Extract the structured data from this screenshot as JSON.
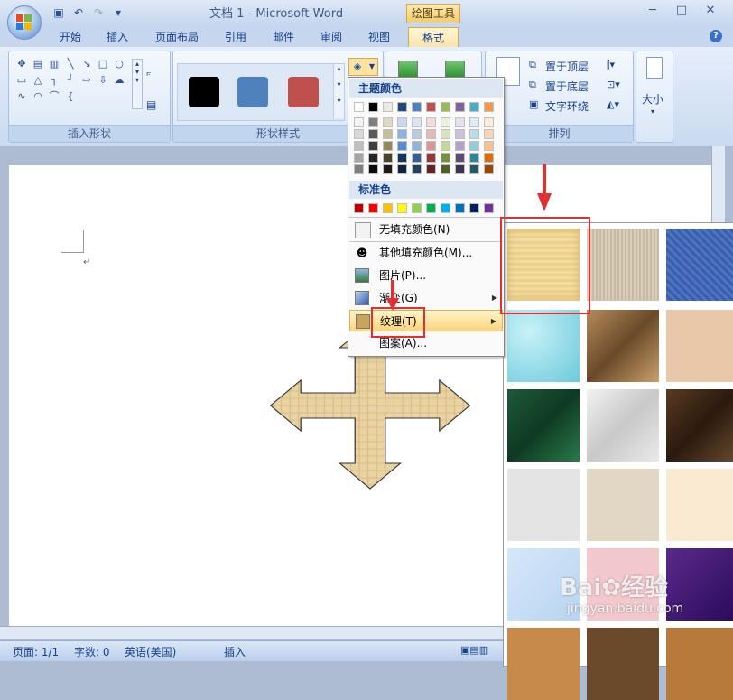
{
  "window": {
    "title": "文档 1 - Microsoft Word",
    "tools_tab": "绘图工具",
    "controls": [
      "─",
      "□",
      "✕"
    ]
  },
  "tabs": [
    {
      "label": "开始"
    },
    {
      "label": "插入"
    },
    {
      "label": "页面布局"
    },
    {
      "label": "引用"
    },
    {
      "label": "邮件"
    },
    {
      "label": "审阅"
    },
    {
      "label": "视图"
    },
    {
      "label": "格式"
    }
  ],
  "ribbon": {
    "groups": {
      "insert_shapes": "插入形状",
      "shape_styles": "形状样式",
      "arrange": "排列"
    },
    "arrange_items": [
      "置于顶层",
      "置于底层",
      "文字环绕"
    ],
    "size_label": "大小",
    "style_swatches": [
      "#000000",
      "#4f81bd",
      "#c0504d"
    ],
    "partial_text": "置"
  },
  "fill_menu": {
    "theme_colors_header": "主题颜色",
    "standard_colors_header": "标准色",
    "theme_top_row": [
      "#ffffff",
      "#000000",
      "#eeece1",
      "#1f497d",
      "#4f81bd",
      "#c0504d",
      "#9bbb59",
      "#8064a2",
      "#4bacc6",
      "#f79646"
    ],
    "theme_shades": [
      [
        "#f2f2f2",
        "#7f7f7f",
        "#ddd9c3",
        "#c6d9f0",
        "#dbe5f1",
        "#f2dcdb",
        "#ebf1dd",
        "#e5e0ec",
        "#dbeef3",
        "#fdeada"
      ],
      [
        "#d8d8d8",
        "#595959",
        "#c4bd97",
        "#8db3e2",
        "#b8cce4",
        "#e5b9b7",
        "#d7e3bc",
        "#ccc1d9",
        "#b7dde8",
        "#fbd5b5"
      ],
      [
        "#bfbfbf",
        "#3f3f3f",
        "#938953",
        "#548dd4",
        "#95b3d7",
        "#d99694",
        "#c3d69b",
        "#b2a2c7",
        "#92cddc",
        "#fac08f"
      ],
      [
        "#a5a5a5",
        "#262626",
        "#494429",
        "#17365d",
        "#366092",
        "#953734",
        "#76923c",
        "#5f497a",
        "#31859b",
        "#e36c09"
      ],
      [
        "#7f7f7f",
        "#0c0c0c",
        "#1d1b10",
        "#0f243e",
        "#244061",
        "#632423",
        "#4f6128",
        "#3f3151",
        "#205867",
        "#974806"
      ]
    ],
    "standard_colors": [
      "#c00000",
      "#ff0000",
      "#ffc000",
      "#ffff00",
      "#92d050",
      "#00b050",
      "#00b0f0",
      "#0070c0",
      "#002060",
      "#7030a0"
    ],
    "items": {
      "no_fill": "无填充颜色(N)",
      "more_colors": "其他填充颜色(M)...",
      "picture": "图片(P)...",
      "gradient": "渐变(G)",
      "texture": "纹理(T)",
      "pattern": "图案(A)..."
    }
  },
  "status": {
    "page": "页面: 1/1",
    "words": "字数: 0",
    "language": "英语(美国)",
    "mode": "插入"
  },
  "watermark": {
    "brand": "Bai",
    "brand2": "经验",
    "url": "jingyan.baidu.com"
  }
}
